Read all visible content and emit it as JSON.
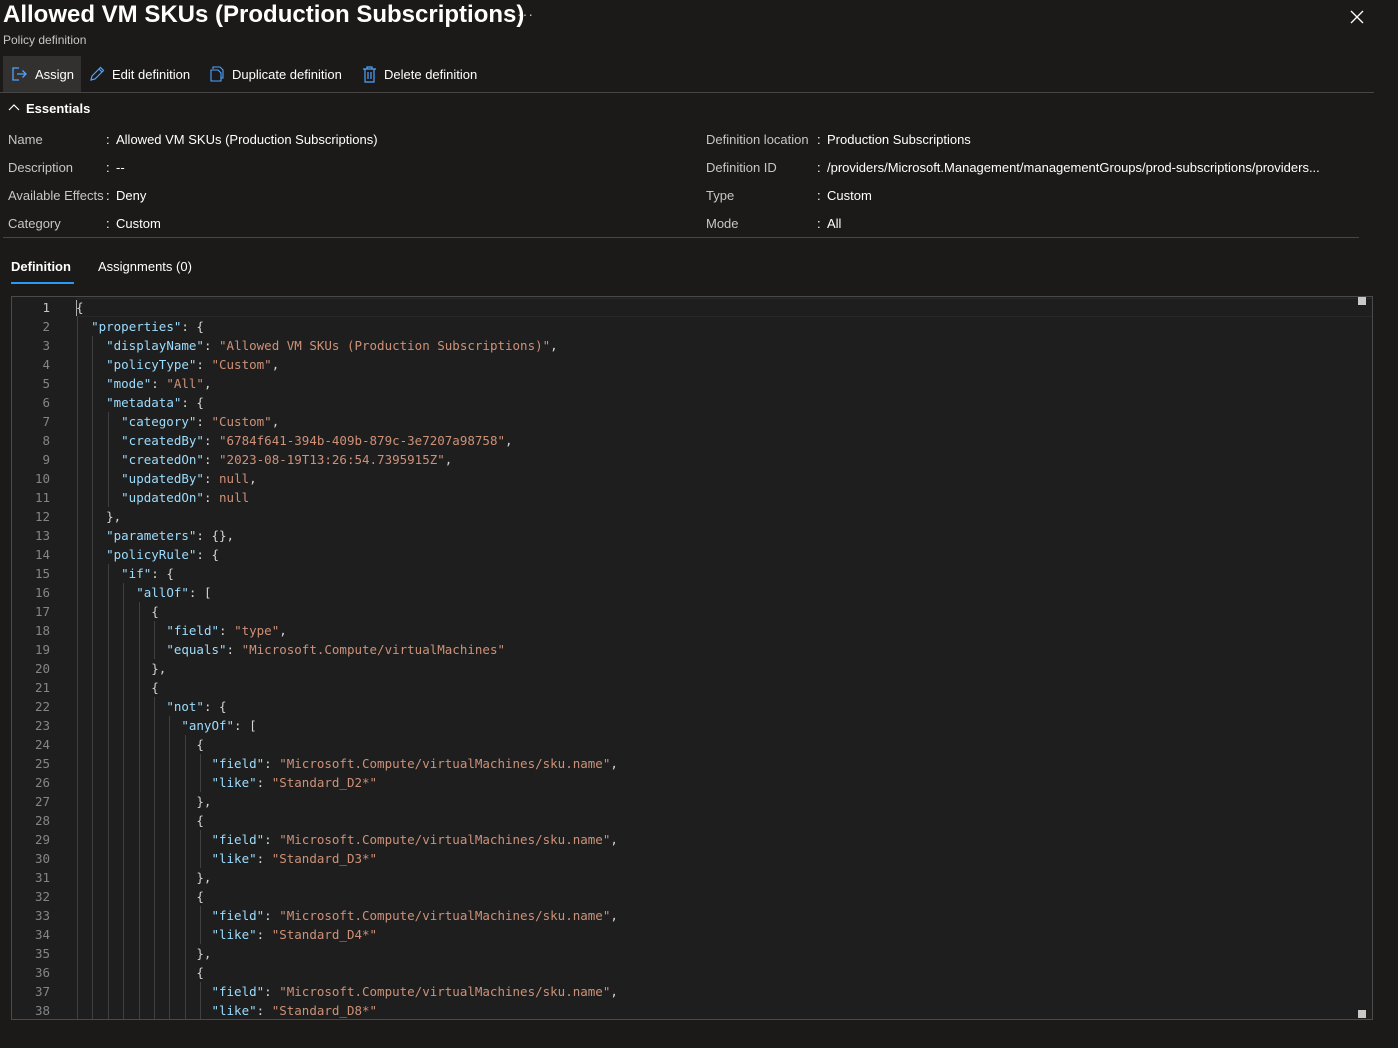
{
  "header": {
    "title": "Allowed VM SKUs (Production Subscriptions)",
    "subtitle": "Policy definition",
    "more_label": "···"
  },
  "toolbar": {
    "assign": "Assign",
    "edit": "Edit definition",
    "duplicate": "Duplicate definition",
    "delete": "Delete definition"
  },
  "essentials": {
    "heading": "Essentials",
    "left": [
      {
        "label": "Name",
        "value": "Allowed VM SKUs (Production Subscriptions)"
      },
      {
        "label": "Description",
        "value": "--"
      },
      {
        "label": "Available Effects",
        "value": "Deny"
      },
      {
        "label": "Category",
        "value": "Custom"
      }
    ],
    "right": [
      {
        "label": "Definition location",
        "value": "Production Subscriptions"
      },
      {
        "label": "Definition ID",
        "value": "/providers/Microsoft.Management/managementGroups/prod-subscriptions/providers..."
      },
      {
        "label": "Type",
        "value": "Custom"
      },
      {
        "label": "Mode",
        "value": "All"
      }
    ],
    "colon": ":"
  },
  "tabs": [
    {
      "label": "Definition",
      "active": true
    },
    {
      "label": "Assignments (0)",
      "active": false
    }
  ],
  "editor": {
    "lines": [
      [
        [
          "p",
          "{"
        ]
      ],
      [
        [
          "p",
          "  "
        ],
        [
          "k",
          "\"properties\""
        ],
        [
          "p",
          ": {"
        ]
      ],
      [
        [
          "p",
          "    "
        ],
        [
          "k",
          "\"displayName\""
        ],
        [
          "p",
          ": "
        ],
        [
          "s",
          "\"Allowed VM SKUs (Production Subscriptions)\""
        ],
        [
          "p",
          ","
        ]
      ],
      [
        [
          "p",
          "    "
        ],
        [
          "k",
          "\"policyType\""
        ],
        [
          "p",
          ": "
        ],
        [
          "s",
          "\"Custom\""
        ],
        [
          "p",
          ","
        ]
      ],
      [
        [
          "p",
          "    "
        ],
        [
          "k",
          "\"mode\""
        ],
        [
          "p",
          ": "
        ],
        [
          "s",
          "\"All\""
        ],
        [
          "p",
          ","
        ]
      ],
      [
        [
          "p",
          "    "
        ],
        [
          "k",
          "\"metadata\""
        ],
        [
          "p",
          ": {"
        ]
      ],
      [
        [
          "p",
          "      "
        ],
        [
          "k",
          "\"category\""
        ],
        [
          "p",
          ": "
        ],
        [
          "s",
          "\"Custom\""
        ],
        [
          "p",
          ","
        ]
      ],
      [
        [
          "p",
          "      "
        ],
        [
          "k",
          "\"createdBy\""
        ],
        [
          "p",
          ": "
        ],
        [
          "s",
          "\"6784f641-394b-409b-879c-3e7207a98758\""
        ],
        [
          "p",
          ","
        ]
      ],
      [
        [
          "p",
          "      "
        ],
        [
          "k",
          "\"createdOn\""
        ],
        [
          "p",
          ": "
        ],
        [
          "s",
          "\"2023-08-19T13:26:54.7395915Z\""
        ],
        [
          "p",
          ","
        ]
      ],
      [
        [
          "p",
          "      "
        ],
        [
          "k",
          "\"updatedBy\""
        ],
        [
          "p",
          ": "
        ],
        [
          "n",
          "null"
        ],
        [
          "p",
          ","
        ]
      ],
      [
        [
          "p",
          "      "
        ],
        [
          "k",
          "\"updatedOn\""
        ],
        [
          "p",
          ": "
        ],
        [
          "n",
          "null"
        ]
      ],
      [
        [
          "p",
          "    },"
        ]
      ],
      [
        [
          "p",
          "    "
        ],
        [
          "k",
          "\"parameters\""
        ],
        [
          "p",
          ": {},"
        ]
      ],
      [
        [
          "p",
          "    "
        ],
        [
          "k",
          "\"policyRule\""
        ],
        [
          "p",
          ": {"
        ]
      ],
      [
        [
          "p",
          "      "
        ],
        [
          "k",
          "\"if\""
        ],
        [
          "p",
          ": {"
        ]
      ],
      [
        [
          "p",
          "        "
        ],
        [
          "k",
          "\"allOf\""
        ],
        [
          "p",
          ": ["
        ]
      ],
      [
        [
          "p",
          "          {"
        ]
      ],
      [
        [
          "p",
          "            "
        ],
        [
          "k",
          "\"field\""
        ],
        [
          "p",
          ": "
        ],
        [
          "s",
          "\"type\""
        ],
        [
          "p",
          ","
        ]
      ],
      [
        [
          "p",
          "            "
        ],
        [
          "k",
          "\"equals\""
        ],
        [
          "p",
          ": "
        ],
        [
          "s",
          "\"Microsoft.Compute/virtualMachines\""
        ]
      ],
      [
        [
          "p",
          "          },"
        ]
      ],
      [
        [
          "p",
          "          {"
        ]
      ],
      [
        [
          "p",
          "            "
        ],
        [
          "k",
          "\"not\""
        ],
        [
          "p",
          ": {"
        ]
      ],
      [
        [
          "p",
          "              "
        ],
        [
          "k",
          "\"anyOf\""
        ],
        [
          "p",
          ": ["
        ]
      ],
      [
        [
          "p",
          "                {"
        ]
      ],
      [
        [
          "p",
          "                  "
        ],
        [
          "k",
          "\"field\""
        ],
        [
          "p",
          ": "
        ],
        [
          "s",
          "\"Microsoft.Compute/virtualMachines/sku.name\""
        ],
        [
          "p",
          ","
        ]
      ],
      [
        [
          "p",
          "                  "
        ],
        [
          "k",
          "\"like\""
        ],
        [
          "p",
          ": "
        ],
        [
          "s",
          "\"Standard_D2*\""
        ]
      ],
      [
        [
          "p",
          "                },"
        ]
      ],
      [
        [
          "p",
          "                {"
        ]
      ],
      [
        [
          "p",
          "                  "
        ],
        [
          "k",
          "\"field\""
        ],
        [
          "p",
          ": "
        ],
        [
          "s",
          "\"Microsoft.Compute/virtualMachines/sku.name\""
        ],
        [
          "p",
          ","
        ]
      ],
      [
        [
          "p",
          "                  "
        ],
        [
          "k",
          "\"like\""
        ],
        [
          "p",
          ": "
        ],
        [
          "s",
          "\"Standard_D3*\""
        ]
      ],
      [
        [
          "p",
          "                },"
        ]
      ],
      [
        [
          "p",
          "                {"
        ]
      ],
      [
        [
          "p",
          "                  "
        ],
        [
          "k",
          "\"field\""
        ],
        [
          "p",
          ": "
        ],
        [
          "s",
          "\"Microsoft.Compute/virtualMachines/sku.name\""
        ],
        [
          "p",
          ","
        ]
      ],
      [
        [
          "p",
          "                  "
        ],
        [
          "k",
          "\"like\""
        ],
        [
          "p",
          ": "
        ],
        [
          "s",
          "\"Standard_D4*\""
        ]
      ],
      [
        [
          "p",
          "                },"
        ]
      ],
      [
        [
          "p",
          "                {"
        ]
      ],
      [
        [
          "p",
          "                  "
        ],
        [
          "k",
          "\"field\""
        ],
        [
          "p",
          ": "
        ],
        [
          "s",
          "\"Microsoft.Compute/virtualMachines/sku.name\""
        ],
        [
          "p",
          ","
        ]
      ],
      [
        [
          "p",
          "                  "
        ],
        [
          "k",
          "\"like\""
        ],
        [
          "p",
          ": "
        ],
        [
          "s",
          "\"Standard_D8*\""
        ]
      ]
    ],
    "line_numbers": [
      "1",
      "2",
      "3",
      "4",
      "5",
      "6",
      "7",
      "8",
      "9",
      "10",
      "11",
      "12",
      "13",
      "14",
      "15",
      "16",
      "17",
      "18",
      "19",
      "20",
      "21",
      "22",
      "23",
      "24",
      "25",
      "26",
      "27",
      "28",
      "29",
      "30",
      "31",
      "32",
      "33",
      "34",
      "35",
      "36",
      "37",
      "38"
    ],
    "colors": {
      "key": "#9cdcfe",
      "string": "#ce9178",
      "punct": "#d4d4d4"
    }
  }
}
